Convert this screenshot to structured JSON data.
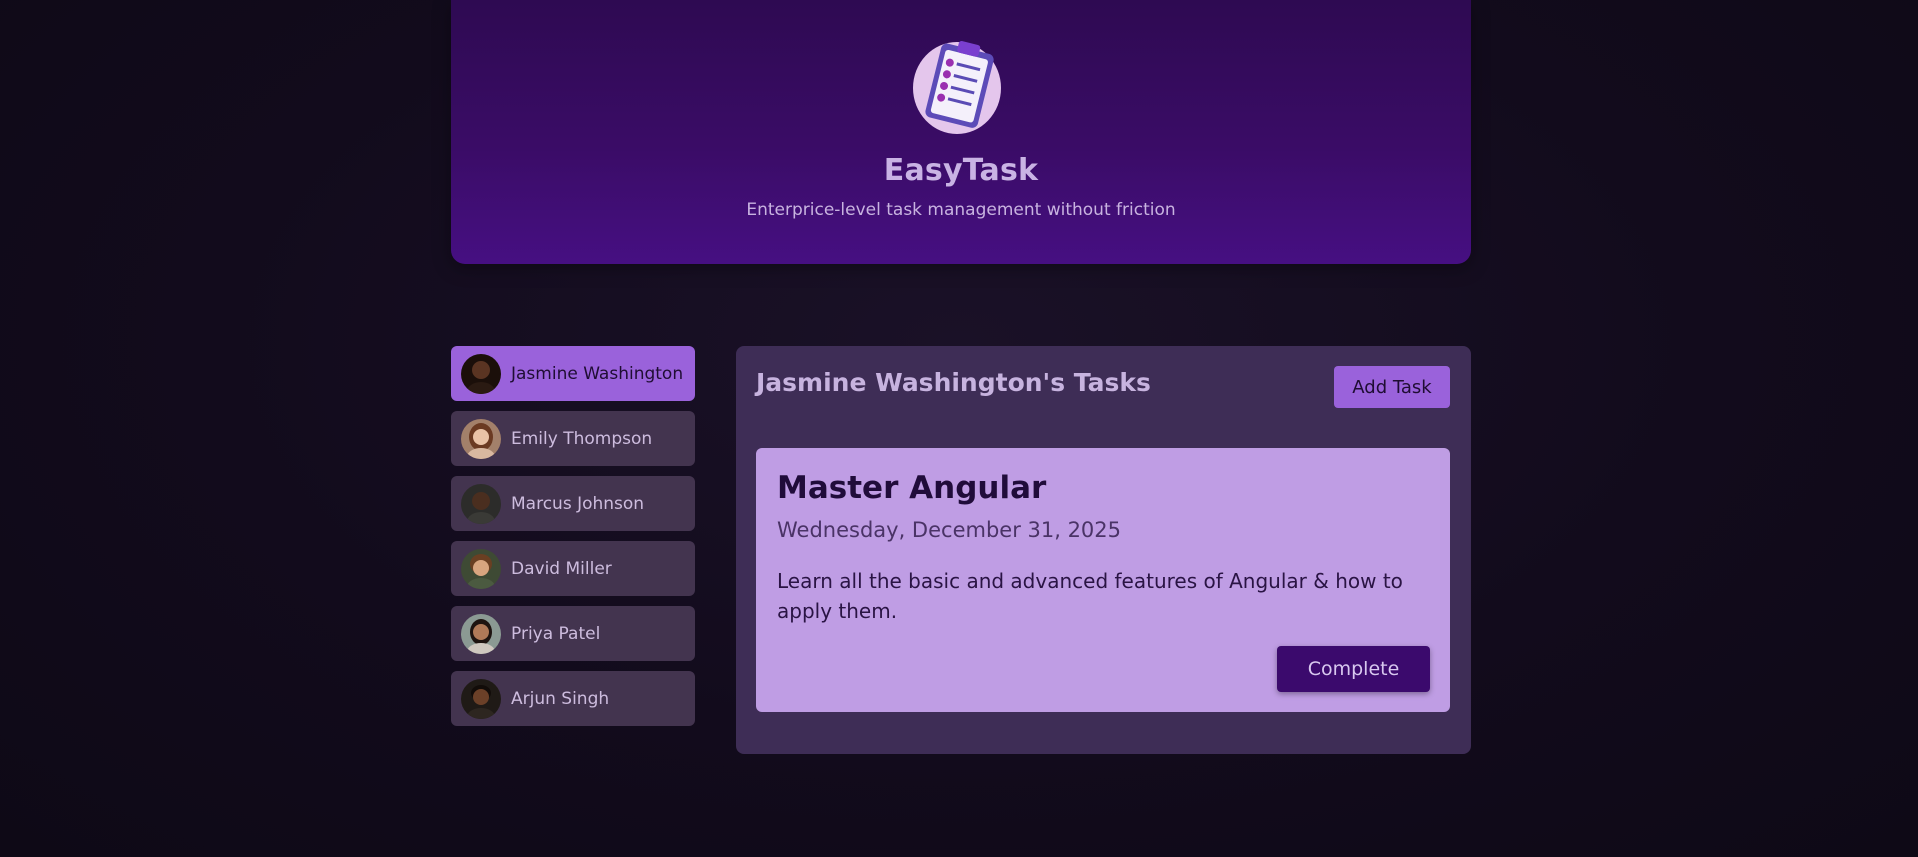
{
  "header": {
    "title": "EasyTask",
    "subtitle": "Enterprice-level task management without friction",
    "logo_icon": "clipboard-checklist-icon"
  },
  "users": [
    {
      "name": "Jasmine Washington",
      "selected": true,
      "avatar_bg": "#1b0f0a",
      "skin": "#5a3422"
    },
    {
      "name": "Emily Thompson",
      "selected": false,
      "avatar_bg": "#a3806a",
      "skin": "#e9c2a6"
    },
    {
      "name": "Marcus Johnson",
      "selected": false,
      "avatar_bg": "#2c2c2a",
      "skin": "#4a2e1f"
    },
    {
      "name": "David Miller",
      "selected": false,
      "avatar_bg": "#3e4a34",
      "skin": "#d8a57f"
    },
    {
      "name": "Priya Patel",
      "selected": false,
      "avatar_bg": "#8b9a93",
      "skin": "#b07a58"
    },
    {
      "name": "Arjun Singh",
      "selected": false,
      "avatar_bg": "#1f1a16",
      "skin": "#6b4028"
    }
  ],
  "tasks_panel": {
    "title": "Jasmine Washington's Tasks",
    "add_task_label": "Add Task"
  },
  "task": {
    "title": "Master Angular",
    "date": "Wednesday, December 31, 2025",
    "description": "Learn all the basic and advanced features of Angular & how to apply them.",
    "complete_label": "Complete"
  },
  "colors": {
    "accent": "#9a62db",
    "header": "#3a0c66",
    "panel": "#3e2d56",
    "card": "#bf9de4",
    "complete_button": "#3b0a6d"
  }
}
